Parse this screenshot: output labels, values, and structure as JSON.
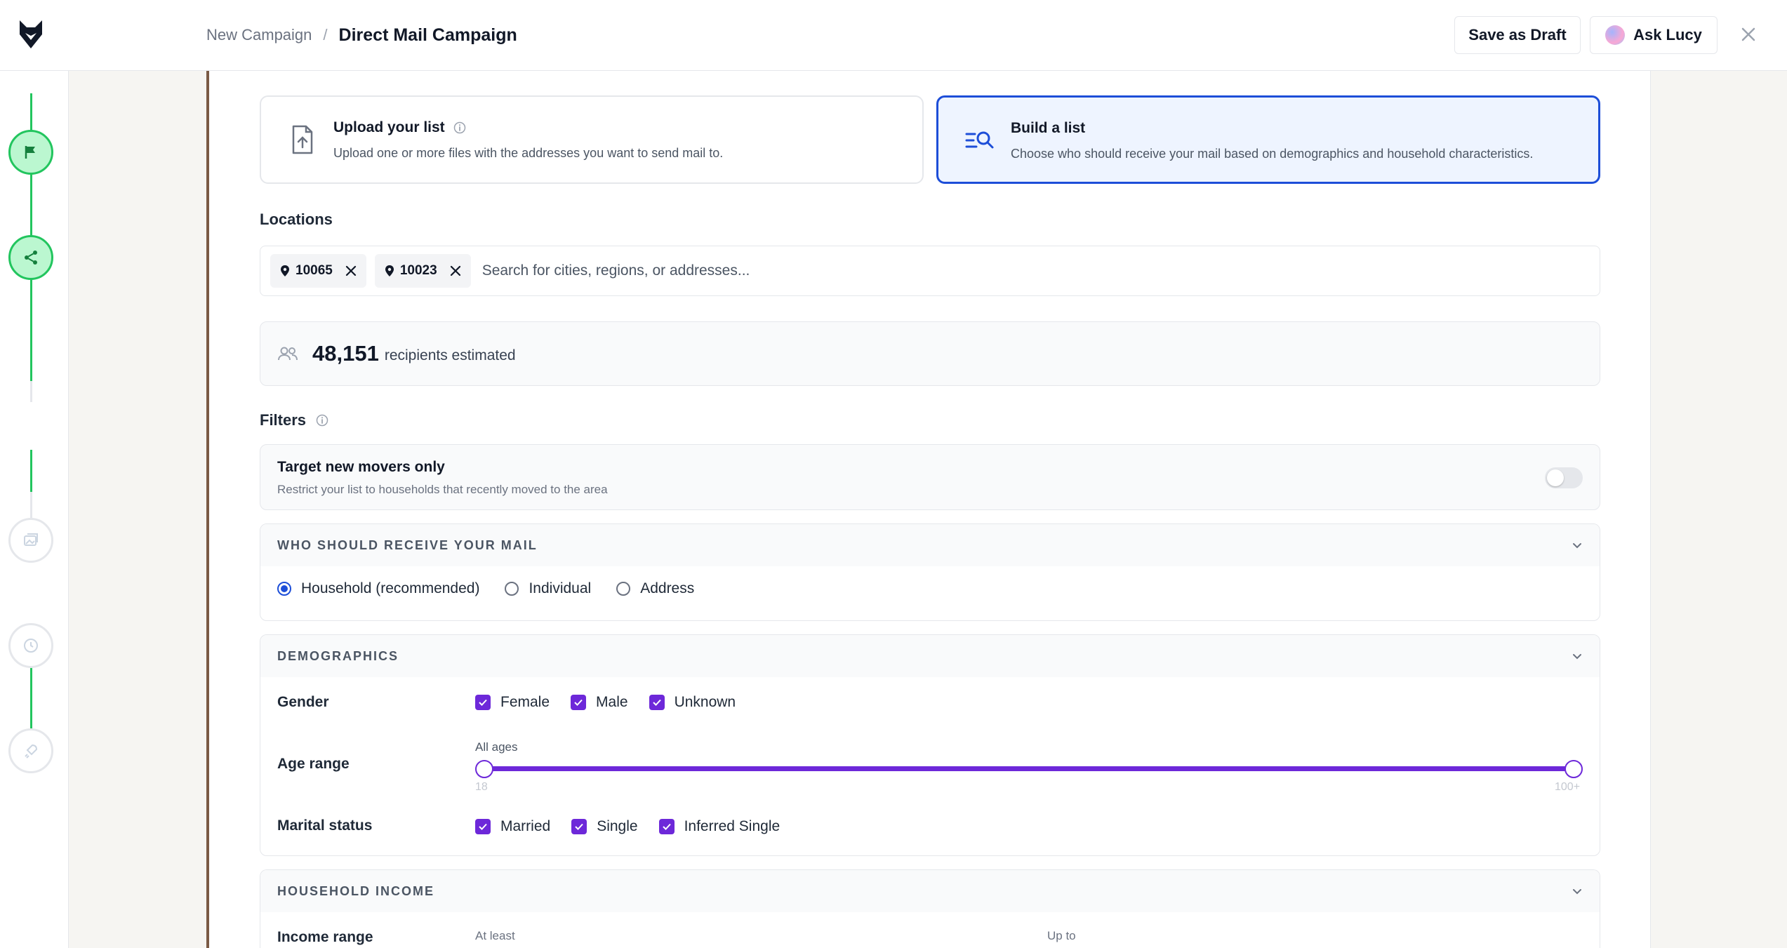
{
  "header": {
    "breadcrumb_parent": "New Campaign",
    "breadcrumb_separator": "/",
    "breadcrumb_current": "Direct Mail Campaign",
    "save_draft_label": "Save as Draft",
    "ask_lucy_label": "Ask Lucy"
  },
  "steps": [
    {
      "icon": "flag-icon",
      "state": "done"
    },
    {
      "icon": "share-icon",
      "state": "done"
    },
    {
      "icon": "images-icon",
      "state": "todo"
    },
    {
      "icon": "clock-icon",
      "state": "todo"
    },
    {
      "icon": "rocket-icon",
      "state": "todo"
    }
  ],
  "source_options": {
    "upload": {
      "title": "Upload your list",
      "description": "Upload one or more files with the addresses you want to send mail to."
    },
    "build": {
      "title": "Build a list",
      "description": "Choose who should receive your mail based on demographics and household characteristics.",
      "selected": true
    }
  },
  "locations": {
    "label": "Locations",
    "chips": [
      "10065",
      "10023"
    ],
    "placeholder": "Search for cities, regions, or addresses..."
  },
  "estimate": {
    "count": "48,151",
    "text": "recipients estimated"
  },
  "filters": {
    "label": "Filters",
    "new_movers": {
      "title": "Target new movers only",
      "description": "Restrict your list to households that recently moved to the area",
      "enabled": false
    }
  },
  "recipient_panel": {
    "heading": "WHO SHOULD RECEIVE YOUR MAIL",
    "options": [
      "Household (recommended)",
      "Individual",
      "Address"
    ],
    "selected": "Household (recommended)"
  },
  "demographics": {
    "heading": "DEMOGRAPHICS",
    "gender": {
      "label": "Gender",
      "options": [
        "Female",
        "Male",
        "Unknown"
      ]
    },
    "age_range": {
      "label": "Age range",
      "caption": "All ages",
      "min_label": "18",
      "max_label": "100+"
    },
    "marital_status": {
      "label": "Marital status",
      "options": [
        "Married",
        "Single",
        "Inferred Single"
      ]
    }
  },
  "household_income": {
    "heading": "HOUSEHOLD INCOME",
    "range_label": "Income range",
    "min_caption": "At least",
    "max_caption": "Up to"
  },
  "colors": {
    "accent_blue": "#1d4ed8",
    "accent_purple": "#6d28d9",
    "step_done": "#22c55e"
  }
}
